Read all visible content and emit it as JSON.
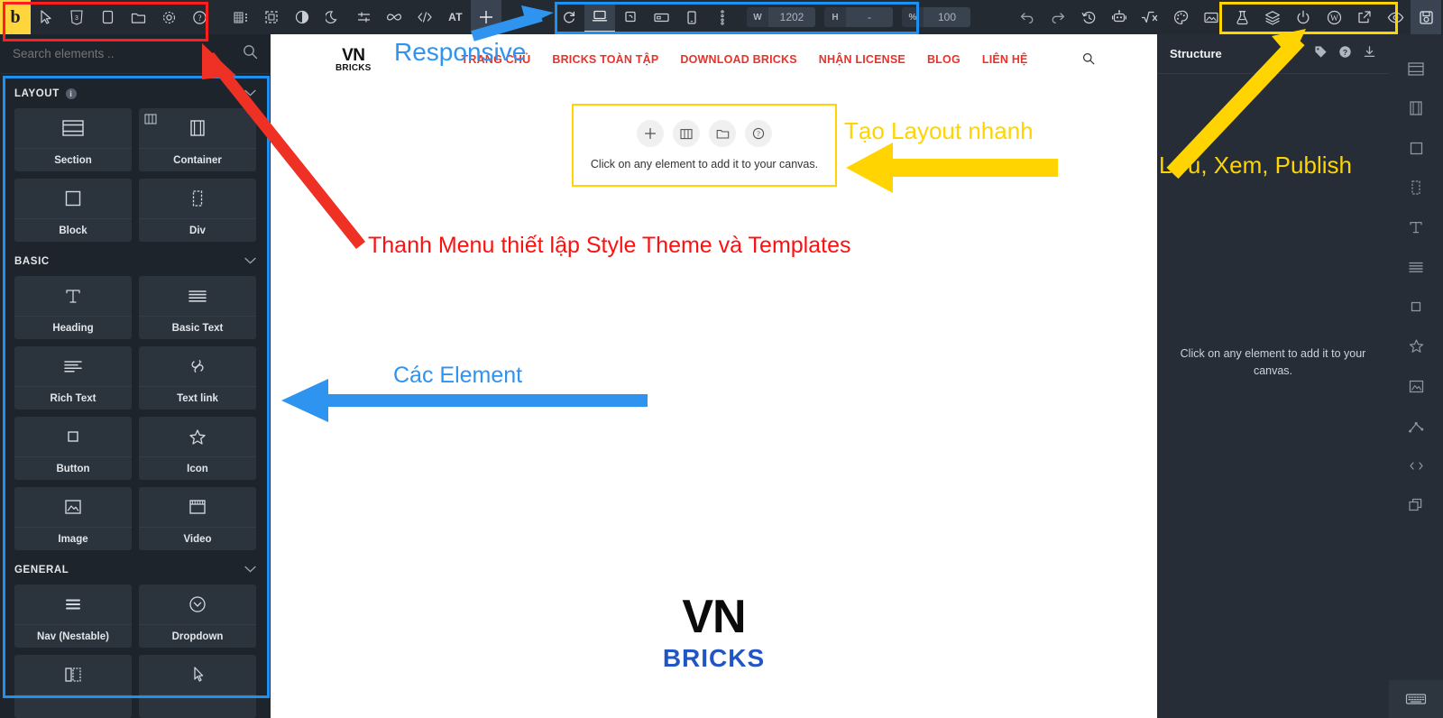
{
  "topbar": {
    "logo_label": "b",
    "left_icons": [
      {
        "name": "pointer-icon",
        "label": "Select"
      },
      {
        "name": "css-icon",
        "label": "CSS"
      },
      {
        "name": "page-icon",
        "label": "Page"
      },
      {
        "name": "folder-icon",
        "label": "Templates"
      },
      {
        "name": "gear-icon",
        "label": "Settings"
      },
      {
        "name": "help-icon",
        "label": "Help"
      }
    ],
    "mid_icons": [
      {
        "name": "grid-list-icon",
        "label": "Structure panel"
      },
      {
        "name": "frame-icon",
        "label": "Canvas frame"
      },
      {
        "name": "contrast-icon",
        "label": "Contrast"
      },
      {
        "name": "moon-icon",
        "label": "Dark mode"
      },
      {
        "name": "sliders-icon",
        "label": "Adjustments"
      },
      {
        "name": "infinity-icon",
        "label": "Infinite"
      },
      {
        "name": "code-icon",
        "label": "Code"
      },
      {
        "name": "at-icon",
        "label": "AT"
      },
      {
        "name": "plus-icon",
        "label": "Add element"
      }
    ],
    "right_icons": [
      {
        "name": "undo-icon",
        "label": "Undo"
      },
      {
        "name": "redo-icon",
        "label": "Redo"
      },
      {
        "name": "history-icon",
        "label": "Revisions"
      },
      {
        "name": "robot-icon",
        "label": "AI"
      },
      {
        "name": "formula-icon",
        "label": "Formula"
      },
      {
        "name": "palette-icon",
        "label": "Theme styles"
      },
      {
        "name": "image-icon",
        "label": "Media"
      },
      {
        "name": "flask-icon",
        "label": "Lab"
      }
    ],
    "publish_icons": [
      {
        "name": "layers-icon",
        "label": "Layers"
      },
      {
        "name": "power-icon",
        "label": "Power"
      },
      {
        "name": "wordpress-icon",
        "label": "WordPress"
      },
      {
        "name": "external-link-icon",
        "label": "Open in new tab"
      },
      {
        "name": "eye-icon",
        "label": "Preview"
      },
      {
        "name": "save-icon",
        "label": "Save"
      }
    ]
  },
  "responsive": {
    "refresh_label": "Refresh",
    "devices": [
      {
        "name": "device-desktop",
        "label": "Desktop",
        "selected": true
      },
      {
        "name": "device-laptop",
        "label": "Laptop",
        "selected": false
      },
      {
        "name": "device-tablet-landscape",
        "label": "Tablet landscape",
        "selected": false
      },
      {
        "name": "device-mobile",
        "label": "Mobile",
        "selected": false
      }
    ],
    "more_label": "More breakpoints",
    "width_label": "W",
    "width_value": "1202",
    "height_label": "H",
    "height_value": "-",
    "zoom_label": "%",
    "zoom_value": "100"
  },
  "sidebar": {
    "search_placeholder": "Search elements ..",
    "search_value": "",
    "groups": [
      {
        "title": "LAYOUT",
        "has_info": true,
        "items": [
          {
            "label": "Section",
            "icon": "section-icon",
            "corner": false
          },
          {
            "label": "Container",
            "icon": "container-icon",
            "corner": true
          },
          {
            "label": "Block",
            "icon": "block-icon",
            "corner": false
          },
          {
            "label": "Div",
            "icon": "div-icon",
            "corner": false
          }
        ]
      },
      {
        "title": "BASIC",
        "has_info": false,
        "items": [
          {
            "label": "Heading",
            "icon": "heading-icon",
            "corner": false
          },
          {
            "label": "Basic Text",
            "icon": "basic-text-icon",
            "corner": false
          },
          {
            "label": "Rich Text",
            "icon": "rich-text-icon",
            "corner": false
          },
          {
            "label": "Text link",
            "icon": "link-icon",
            "corner": false
          },
          {
            "label": "Button",
            "icon": "button-icon",
            "corner": false
          },
          {
            "label": "Icon",
            "icon": "star-icon",
            "corner": false
          },
          {
            "label": "Image",
            "icon": "image-icon",
            "corner": false
          },
          {
            "label": "Video",
            "icon": "video-icon",
            "corner": false
          }
        ]
      },
      {
        "title": "GENERAL",
        "has_info": false,
        "items": [
          {
            "label": "Nav (Nestable)",
            "icon": "nav-icon",
            "corner": false
          },
          {
            "label": "Dropdown",
            "icon": "dropdown-icon",
            "corner": false
          }
        ]
      }
    ]
  },
  "canvas": {
    "site": {
      "logo_line1": "VN",
      "logo_line2": "BRICKS",
      "nav": [
        {
          "label": "TRANG CHỦ"
        },
        {
          "label": "BRICKS TOÀN TẬP"
        },
        {
          "label": "DOWNLOAD BRICKS"
        },
        {
          "label": "NHẬN LICENSE"
        },
        {
          "label": "BLOG"
        },
        {
          "label": "LIÊN HỆ"
        }
      ],
      "search_icon": "search-icon",
      "brand_big_line1": "VN",
      "brand_big_line2": "BRICKS"
    },
    "placeholder": {
      "text": "Click on any element to add it to your canvas.",
      "actions": [
        {
          "name": "add-element-icon",
          "glyph": "+"
        },
        {
          "name": "columns-icon",
          "glyph": "▥"
        },
        {
          "name": "templates-folder-icon",
          "glyph": "🗀"
        },
        {
          "name": "help-circle-icon",
          "glyph": "?"
        }
      ]
    }
  },
  "structure": {
    "title": "Structure",
    "actions": [
      {
        "name": "tag-icon",
        "label": "Labels"
      },
      {
        "name": "help-icon",
        "label": "Help"
      },
      {
        "name": "download-icon",
        "label": "Import"
      }
    ],
    "empty_text": "Click on any element to add it to your canvas."
  },
  "rail": {
    "items": [
      {
        "name": "section-icon",
        "label": "Section"
      },
      {
        "name": "container-icon",
        "label": "Container"
      },
      {
        "name": "block-icon",
        "label": "Block"
      },
      {
        "name": "div-icon",
        "label": "Div"
      },
      {
        "name": "heading-icon",
        "label": "Heading"
      },
      {
        "name": "text-icon",
        "label": "Text"
      },
      {
        "name": "button-icon",
        "label": "Button"
      },
      {
        "name": "star-icon",
        "label": "Icon"
      },
      {
        "name": "image-icon",
        "label": "Image"
      },
      {
        "name": "nestable-icon",
        "label": "Nestable"
      },
      {
        "name": "code-icon",
        "label": "Code"
      },
      {
        "name": "duplicate-icon",
        "label": "Duplicate"
      }
    ],
    "keyboard_icon": "keyboard-icon"
  },
  "annotations": {
    "responsive": "Responsive",
    "menu_style": "Thanh Menu thiết lập Style Theme và Templates",
    "elements": "Các Element",
    "quick_layout": "Tạo Layout nhanh",
    "save_view_publish": "Lưu, Xem, Publish"
  },
  "colors": {
    "red": "#ff1010",
    "blue": "#2f93f0",
    "yellow": "#ffd400",
    "panel_dark": "#1e242b",
    "topbar_dark": "#232a32",
    "nav_red": "#e8322a",
    "brand_blue": "#2255c4"
  }
}
